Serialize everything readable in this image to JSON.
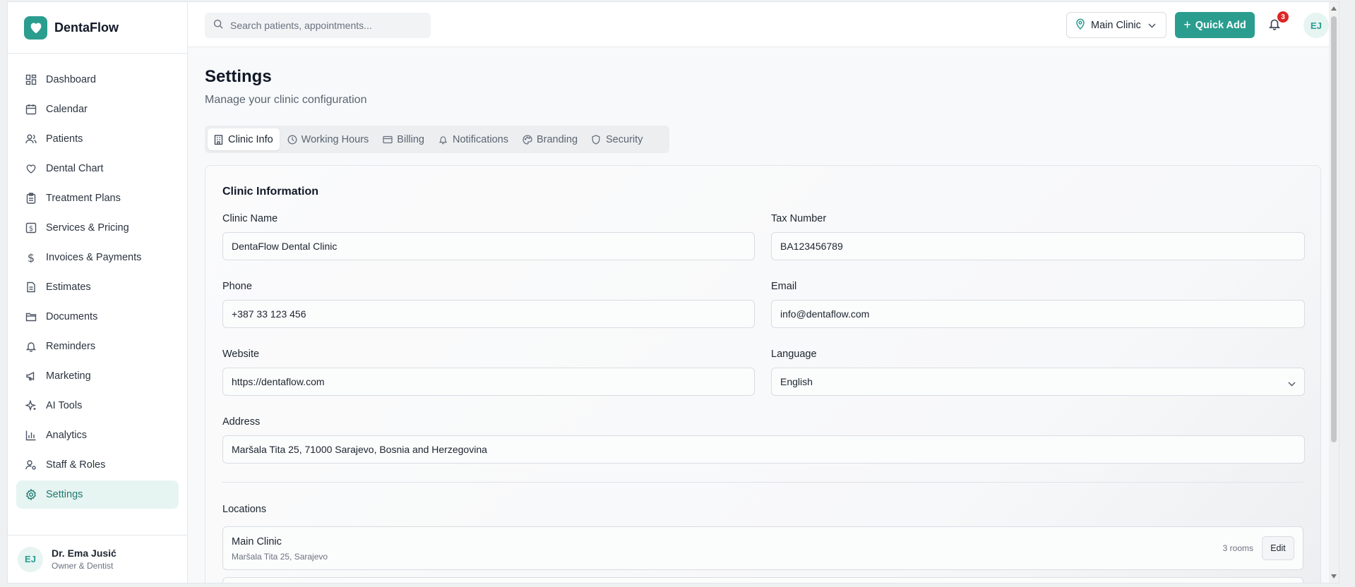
{
  "app": {
    "name": "DentaFlow",
    "brand_color": "#2a9d8f"
  },
  "sidebar": {
    "items": [
      {
        "label": "Dashboard",
        "icon": "dashboard-icon"
      },
      {
        "label": "Calendar",
        "icon": "calendar-icon"
      },
      {
        "label": "Patients",
        "icon": "users-icon"
      },
      {
        "label": "Dental Chart",
        "icon": "heart-icon"
      },
      {
        "label": "Treatment Plans",
        "icon": "clipboard-icon"
      },
      {
        "label": "Services & Pricing",
        "icon": "price-tag-icon"
      },
      {
        "label": "Invoices & Payments",
        "icon": "dollar-icon"
      },
      {
        "label": "Estimates",
        "icon": "file-icon"
      },
      {
        "label": "Documents",
        "icon": "folder-icon"
      },
      {
        "label": "Reminders",
        "icon": "bell-icon"
      },
      {
        "label": "Marketing",
        "icon": "megaphone-icon"
      },
      {
        "label": "AI Tools",
        "icon": "sparkles-icon"
      },
      {
        "label": "Analytics",
        "icon": "bar-chart-icon"
      },
      {
        "label": "Staff & Roles",
        "icon": "user-cog-icon"
      },
      {
        "label": "Settings",
        "icon": "gear-icon",
        "active": true
      }
    ],
    "user": {
      "initials": "EJ",
      "name": "Dr. Ema Jusić",
      "role": "Owner & Dentist"
    }
  },
  "topbar": {
    "search_placeholder": "Search patients, appointments...",
    "clinic": "Main Clinic",
    "quick_add": "Quick Add",
    "notifications_count": "3",
    "user_initials": "EJ"
  },
  "page": {
    "title": "Settings",
    "subtitle": "Manage your clinic configuration",
    "tabs": [
      {
        "label": "Clinic Info",
        "icon": "building-icon",
        "active": true
      },
      {
        "label": "Working Hours",
        "icon": "clock-icon"
      },
      {
        "label": "Billing",
        "icon": "credit-card-icon"
      },
      {
        "label": "Notifications",
        "icon": "bell-icon"
      },
      {
        "label": "Branding",
        "icon": "palette-icon"
      },
      {
        "label": "Security",
        "icon": "shield-icon"
      }
    ]
  },
  "clinic_info": {
    "section_title": "Clinic Information",
    "clinic_name": {
      "label": "Clinic Name",
      "value": "DentaFlow Dental Clinic"
    },
    "tax_number": {
      "label": "Tax Number",
      "value": "BA123456789"
    },
    "phone": {
      "label": "Phone",
      "value": "+387 33 123 456"
    },
    "email": {
      "label": "Email",
      "value": "info@dentaflow.com"
    },
    "website": {
      "label": "Website",
      "value": "https://dentaflow.com"
    },
    "language": {
      "label": "Language",
      "value": "English"
    },
    "address": {
      "label": "Address",
      "value": "Maršala Tita 25, 71000 Sarajevo, Bosnia and Herzegovina"
    }
  },
  "locations": {
    "title": "Locations",
    "items": [
      {
        "name": "Main Clinic",
        "address": "Maršala Tita 25, Sarajevo",
        "rooms": "3 rooms",
        "edit_label": "Edit"
      }
    ]
  }
}
